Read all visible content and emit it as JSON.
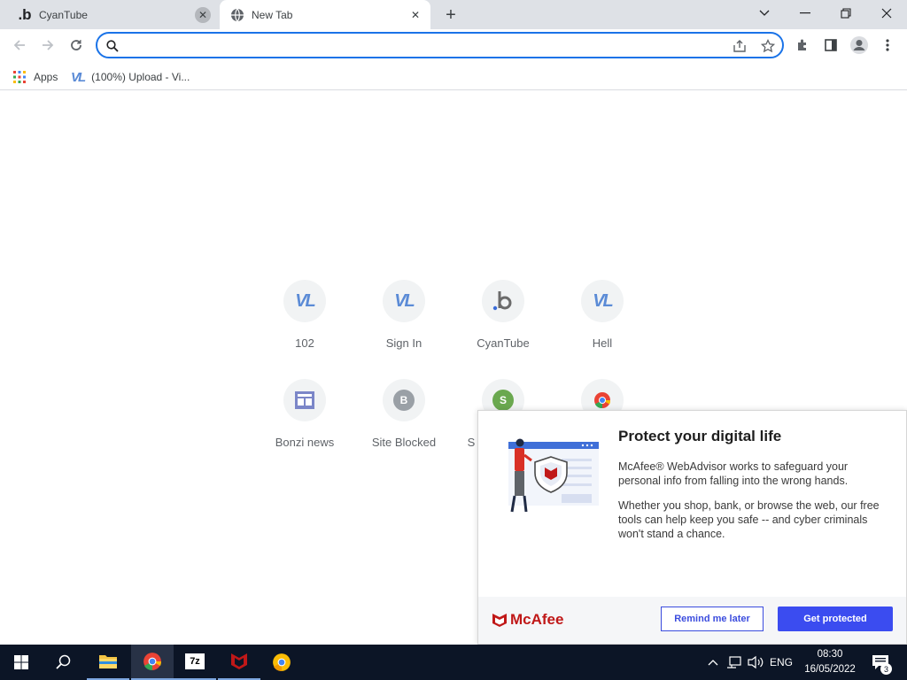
{
  "tabs": [
    {
      "title": "CyanTube",
      "favicon": "b-logo-icon",
      "close": "✕"
    },
    {
      "title": "New Tab",
      "favicon": "globe-icon",
      "close": "✕"
    }
  ],
  "new_tab_symbol": "+",
  "window_controls": {
    "chevron": "chevron-down-icon",
    "minimize": "minimize-icon",
    "restore": "restore-icon",
    "close": "close-icon"
  },
  "omnibox": {
    "value": "",
    "placeholder": ""
  },
  "bookmarks": [
    {
      "label": "Apps",
      "icon": "apps-grid-icon"
    },
    {
      "label": "(100%) Upload - Vi...",
      "icon": "vl-logo-icon"
    }
  ],
  "shortcuts": [
    {
      "label": "102",
      "icon": "vl-logo-icon"
    },
    {
      "label": "Sign In",
      "icon": "vl-logo-icon"
    },
    {
      "label": "CyanTube",
      "icon": "b-logo-icon"
    },
    {
      "label": "Hell",
      "icon": "vl-logo-icon"
    },
    {
      "label": "Bonzi news",
      "icon": "news-icon"
    },
    {
      "label": "Site Blocked",
      "icon": "letter-b-icon",
      "letter": "B"
    },
    {
      "label": "S",
      "icon": "letter-s-icon",
      "letter": "S"
    },
    {
      "label": "",
      "icon": "chrome-icon"
    }
  ],
  "vl_text": "VL",
  "mcafee": {
    "title": "Protect your digital life",
    "para1": "McAfee® WebAdvisor works to safeguard your personal info from falling into the wrong hands.",
    "para2": "Whether you shop, bank, or browse the web, our free tools can help keep you safe -- and cyber criminals won't stand a chance.",
    "brand": "McAfee",
    "remind_label": "Remind me later",
    "protect_label": "Get protected",
    "brand_color": "#c01818",
    "button_color": "#3b4cf0"
  },
  "taskbar": {
    "items": [
      "windows-start-icon",
      "search-icon",
      "file-explorer-icon",
      "chrome-icon",
      "7zip-icon",
      "mcafee-icon",
      "chrome-canary-icon"
    ],
    "sevenzip_label": "7z",
    "lang": "ENG",
    "time": "08:30",
    "date": "16/05/2022",
    "notification_count": "3"
  },
  "colors": {
    "tabstrip": "#dee1e6",
    "accent": "#1a73e8",
    "taskbar": "#0c1526"
  }
}
